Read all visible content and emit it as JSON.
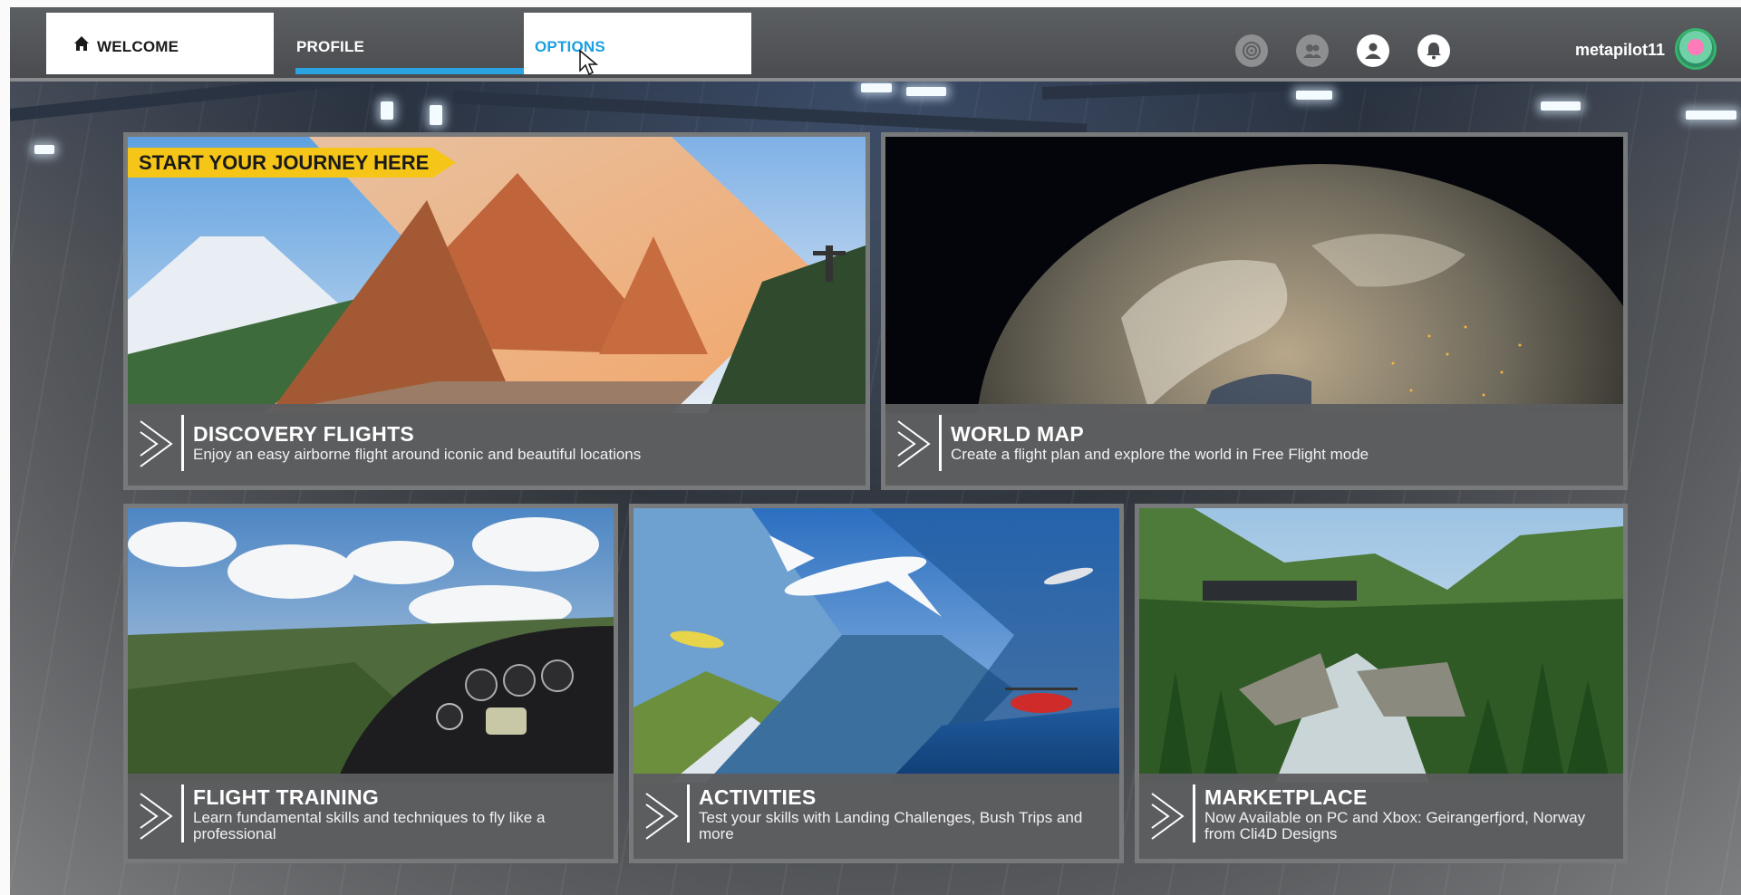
{
  "colors": {
    "accent_blue": "#1a9fe0",
    "tab_underline": "#2aa3e0",
    "banner_yellow": "#f5c518",
    "avatar_ring": "#34b56b"
  },
  "topbar": {
    "tabs": [
      {
        "label": "WELCOME",
        "icon": "home-icon",
        "state": "normal"
      },
      {
        "label": "PROFILE",
        "state": "selected"
      },
      {
        "label": "OPTIONS",
        "state": "hovered"
      }
    ],
    "icons": [
      "activity-icon",
      "friends-icon",
      "profile-icon",
      "notification-bell-icon"
    ],
    "username": "metapilot11"
  },
  "cards": {
    "discovery": {
      "banner": "START YOUR JOURNEY HERE",
      "title": "DISCOVERY FLIGHTS",
      "description": "Enjoy an easy airborne flight around iconic and beautiful locations"
    },
    "worldmap": {
      "title": "WORLD MAP",
      "description": "Create a flight plan and explore the world in Free Flight mode"
    },
    "training": {
      "title": "FLIGHT TRAINING",
      "description": "Learn fundamental skills and techniques to fly like a professional"
    },
    "activities": {
      "title": "ACTIVITIES",
      "description": "Test your skills with Landing Challenges, Bush Trips and more"
    },
    "marketplace": {
      "title": "MARKETPLACE",
      "description": "Now Available on PC and Xbox: Geirangerfjord, Norway from Cli4D Designs"
    }
  }
}
